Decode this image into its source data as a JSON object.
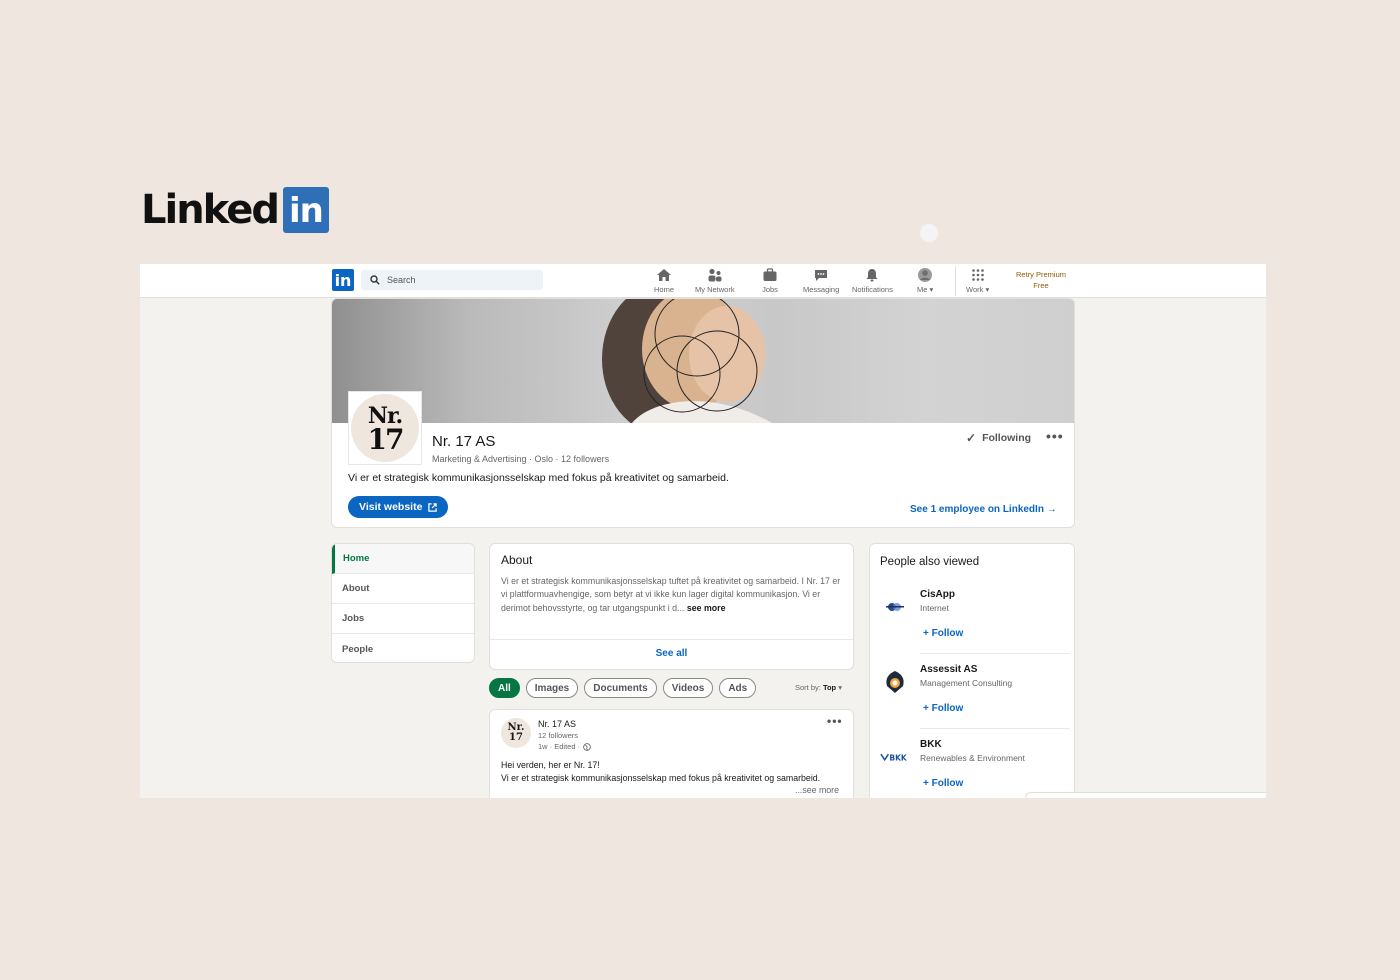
{
  "brand": {
    "word": "Linked",
    "box": "in"
  },
  "nav": {
    "logo": "in",
    "search_placeholder": "Search",
    "items": [
      {
        "label": "Home",
        "icon": "home-icon"
      },
      {
        "label": "My Network",
        "icon": "network-icon"
      },
      {
        "label": "Jobs",
        "icon": "briefcase-icon"
      },
      {
        "label": "Messaging",
        "icon": "messaging-icon"
      },
      {
        "label": "Notifications",
        "icon": "bell-icon"
      },
      {
        "label": "Me",
        "icon": "avatar-icon"
      },
      {
        "label": "Work",
        "icon": "grid-icon"
      }
    ],
    "premium_line1": "Retry Premium",
    "premium_line2": "Free"
  },
  "company": {
    "logo_line1": "Nr.",
    "logo_line2": "17",
    "name": "Nr. 17 AS",
    "meta": "Marketing & Advertising · Oslo · 12 followers",
    "tagline": "Vi er et strategisk kommunikasjonsselskap med fokus på kreativitet og samarbeid.",
    "following_label": "Following",
    "more_label": "•••",
    "visit_label": "Visit website",
    "employees_link": "See 1 employee on LinkedIn →"
  },
  "leftnav": [
    "Home",
    "About",
    "Jobs",
    "People"
  ],
  "about": {
    "title": "About",
    "text": "Vi er et strategisk kommunikasjonsselskap tuftet på kreativitet og samarbeid. I Nr. 17 er vi plattformuavhengige, som betyr at vi ikke kun lager digital kommunikasjon. Vi er derimot behovsstyrte, og tar utgangspunkt i d...",
    "see_more": "see more",
    "see_all": "See all"
  },
  "filters": {
    "chips": [
      "All",
      "Images",
      "Documents",
      "Videos",
      "Ads"
    ],
    "sort_label": "Sort by:",
    "sort_value": "Top"
  },
  "post": {
    "author": "Nr. 17 AS",
    "followers": "12 followers",
    "time": "1w · Edited ·",
    "line1": "Hei verden, her er Nr. 17!",
    "line2": "Vi er et strategisk kommunikasjonsselskap med fokus på kreativitet og samarbeid.",
    "see_more": "...see more",
    "more_label": "•••"
  },
  "people_also_viewed": {
    "title": "People also viewed",
    "items": [
      {
        "name": "CisApp",
        "industry": "Internet",
        "follow": "+ Follow"
      },
      {
        "name": "Assessit AS",
        "industry": "Management Consulting",
        "follow": "+ Follow"
      },
      {
        "name": "BKK",
        "industry": "Renewables & Environment",
        "follow": "+ Follow"
      }
    ]
  },
  "colors": {
    "linkedin_blue": "#0a66c2",
    "active_green": "#057642",
    "premium_gold": "#915907"
  }
}
